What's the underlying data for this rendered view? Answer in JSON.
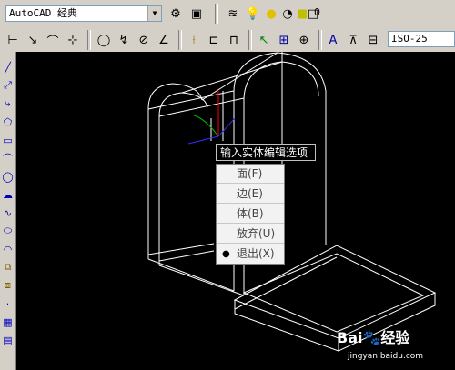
{
  "workspace": {
    "label": "AutoCAD 经典",
    "dropdown_icon": "chevron-down-icon"
  },
  "layer_value": "0",
  "dimstyle_value": "ISO-25",
  "tooltip": "输入实体编辑选项",
  "menu": {
    "items": [
      {
        "label": "面(F)",
        "selected": false
      },
      {
        "label": "边(E)",
        "selected": false
      },
      {
        "label": "体(B)",
        "selected": false
      },
      {
        "label": "放弃(U)",
        "selected": false
      },
      {
        "label": "退出(X)",
        "selected": true
      }
    ]
  },
  "watermark": {
    "main": "Bai🐾经验",
    "url": "jingyan.baidu.com"
  },
  "colors": {
    "canvas": "#000000",
    "model": "#ffffff",
    "axis_x": "#ff0000",
    "axis_y": "#00c000",
    "axis_z": "#0000ff"
  }
}
